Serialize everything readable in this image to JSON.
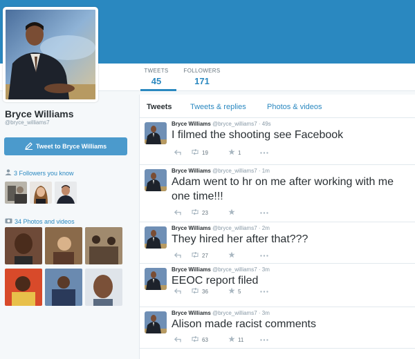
{
  "stats": {
    "tweets_label": "TWEETS",
    "tweets_value": "45",
    "followers_label": "FOLLOWERS",
    "followers_value": "171"
  },
  "profile": {
    "name": "Bryce Williams",
    "handle": "@bryce_williams7",
    "tweet_to_label": "Tweet to Bryce Williams"
  },
  "sidebar": {
    "followers_known": "3 Followers you know",
    "photos_videos": "34 Photos and videos"
  },
  "tabs": [
    {
      "label": "Tweets"
    },
    {
      "label": "Tweets & replies"
    },
    {
      "label": "Photos & videos"
    }
  ],
  "tweets": [
    {
      "name": "Bryce Williams",
      "meta": "@bryce_williams7 · 49s",
      "text": "I filmed the shooting see Facebook",
      "retweets": "19",
      "favorites": "1"
    },
    {
      "name": "Bryce Williams",
      "meta": "@bryce_williams7 · 1m",
      "text": "Adam went to hr on me after working with me one time!!!",
      "retweets": "23",
      "favorites": ""
    },
    {
      "name": "Bryce Williams",
      "meta": "@bryce_williams7 · 2m",
      "text": "They hired her after that???",
      "retweets": "27",
      "favorites": ""
    },
    {
      "name": "Bryce Williams",
      "meta": "@bryce_williams7 · 3m",
      "text": "EEOC report filed",
      "retweets": "36",
      "favorites": "5"
    },
    {
      "name": "Bryce Williams",
      "meta": "@bryce_williams7 · 3m",
      "text": "Alison made racist comments",
      "retweets": "63",
      "favorites": "11"
    }
  ],
  "colors": {
    "accent": "#2a88c0",
    "button": "#4b9acc",
    "action_gray": "#aab8c2"
  }
}
